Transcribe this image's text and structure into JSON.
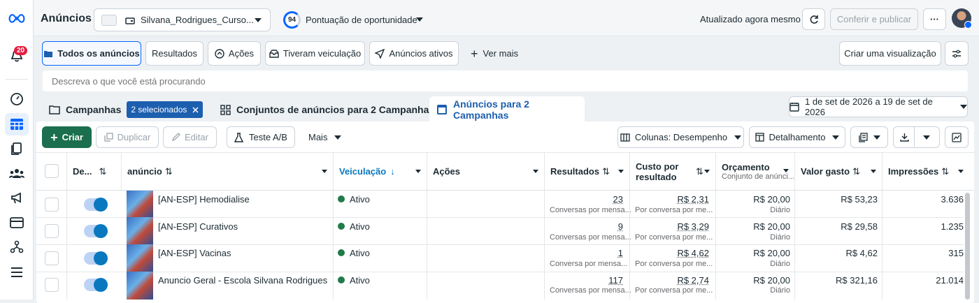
{
  "app": {
    "title": "Anúncios",
    "account": "Silvana_Rodrigues_Curso...",
    "score": "94",
    "score_label": "Pontuação de oportunidade",
    "updated": "Atualizado agora mesmo",
    "review_publish": "Conferir e publicar",
    "more": "···"
  },
  "nav": {
    "notif_count": "20"
  },
  "filters": {
    "all_ads": "Todos os anúncios",
    "results": "Resultados",
    "actions": "Ações",
    "delivered": "Tiveram veiculação",
    "active_ads": "Anúncios ativos",
    "see_more": "Ver mais",
    "create_view": "Criar uma visualização"
  },
  "search": {
    "placeholder": "Descreva o que você está procurando"
  },
  "tabs": {
    "campaigns": "Campanhas",
    "selected": "2 selecionados",
    "adsets": "Conjuntos de anúncios para 2 Campanhas",
    "ads": "Anúncios para 2 Campanhas"
  },
  "daterange": "1 de set de 2026 a 19 de set de 2026",
  "toolbar": {
    "create": "Criar",
    "duplicate": "Duplicar",
    "edit": "Editar",
    "ab_test": "Teste A/B",
    "more": "Mais",
    "columns": "Colunas: Desempenho",
    "breakdown": "Detalhamento"
  },
  "table": {
    "headers": {
      "toggle": "De...",
      "ad": "anúncio",
      "delivery": "Veiculação",
      "actions": "Ações",
      "results": "Resultados",
      "cost": "Custo por resultado",
      "budget": "Orçamento",
      "budget_sub": "Conjunto de anúnci...",
      "spent": "Valor gasto",
      "impressions": "Impressões"
    },
    "rows": [
      {
        "name": "[AN-ESP] Hemodialise",
        "status": "Ativo",
        "results": "23",
        "results_sub": "Conversas por mensa...",
        "cost": "R$ 2,31",
        "cost_sub": "Por conversa por me...",
        "budget": "R$ 20,00",
        "budget_sub": "Diário",
        "spent": "R$ 53,23",
        "impressions": "3.636"
      },
      {
        "name": "[AN-ESP] Curativos",
        "status": "Ativo",
        "results": "9",
        "results_sub": "Conversas por mensa...",
        "cost": "R$ 3,29",
        "cost_sub": "Por conversa por me...",
        "budget": "R$ 20,00",
        "budget_sub": "Diário",
        "spent": "R$ 29,58",
        "impressions": "1.235"
      },
      {
        "name": "[AN-ESP] Vacinas",
        "status": "Ativo",
        "results": "1",
        "results_sub": "Conversa por mensa...",
        "cost": "R$ 4,62",
        "cost_sub": "Por conversa por me...",
        "budget": "R$ 20,00",
        "budget_sub": "Diário",
        "spent": "R$ 4,62",
        "impressions": "315"
      },
      {
        "name": "Anuncio Geral - Escola Silvana Rodrigues",
        "status": "Ativo",
        "results": "117",
        "results_sub": "Conversas por mensa...",
        "cost": "R$ 2,74",
        "cost_sub": "Por conversa por me...",
        "budget": "R$ 20,00",
        "budget_sub": "Diário",
        "spent": "R$ 321,16",
        "impressions": "21.014"
      }
    ]
  },
  "colors": {
    "primary": "#0a78be",
    "create_btn": "#1b6f4e",
    "active_dot": "#1f7b4a",
    "selected_tab": "#1d5faf"
  }
}
